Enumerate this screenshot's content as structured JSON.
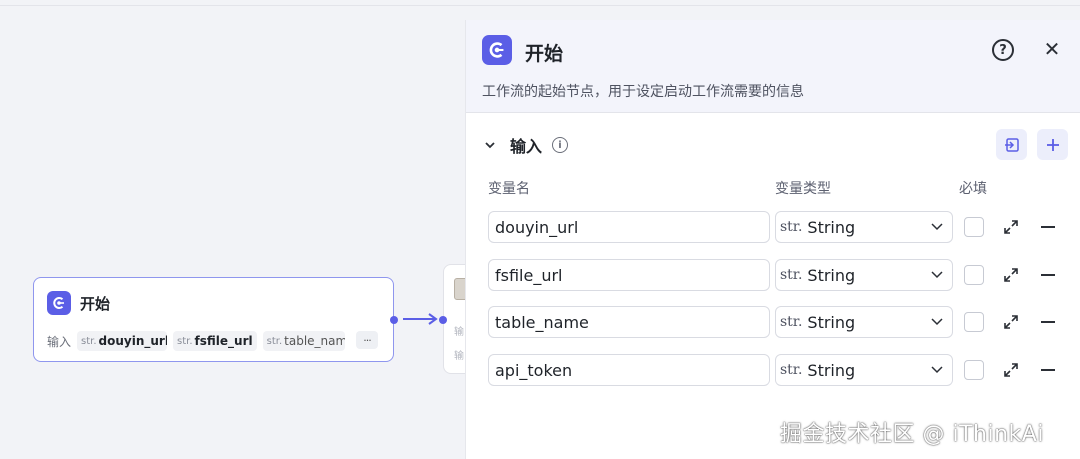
{
  "canvas": {
    "start_node": {
      "title": "开始",
      "inputs_label": "输入",
      "inputs": [
        {
          "type": "str.",
          "name": "douyin_url"
        },
        {
          "type": "str.",
          "name": "fsfile_url"
        },
        {
          "type": "str.",
          "name": "table_name"
        }
      ],
      "more": "···"
    }
  },
  "panel": {
    "title": "开始",
    "description": "工作流的起始节点，用于设定启动工作流需要的信息",
    "section_title": "输入",
    "columns": {
      "name": "变量名",
      "type": "变量类型",
      "required": "必填"
    },
    "rows": [
      {
        "name": "douyin_url",
        "type_prefix": "str.",
        "type": "String",
        "required": false
      },
      {
        "name": "fsfile_url",
        "type_prefix": "str.",
        "type": "String",
        "required": false
      },
      {
        "name": "table_name",
        "type_prefix": "str.",
        "type": "String",
        "required": false
      },
      {
        "name": "api_token",
        "type_prefix": "str.",
        "type": "String",
        "required": false
      }
    ]
  },
  "watermark": "掘金技术社区 @ iThinkAi",
  "colors": {
    "accent": "#5b5ee6",
    "panel_header_bg": "#f3f4fb",
    "canvas_bg": "#f2f3f7"
  }
}
